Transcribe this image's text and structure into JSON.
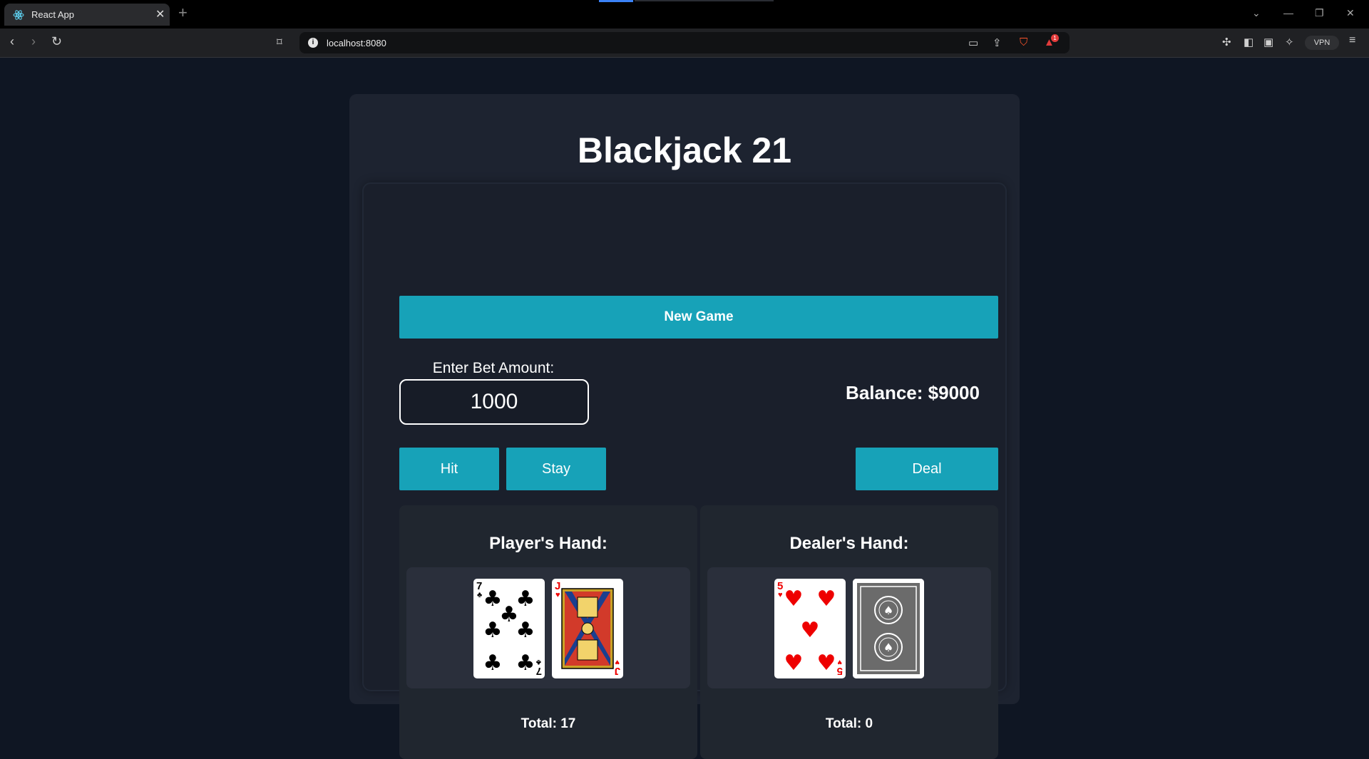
{
  "browser": {
    "tab_title": "React App",
    "tab_close": "✕",
    "new_tab": "+",
    "url": "localhost:8080",
    "vpn_label": "VPN",
    "notification_count": "1"
  },
  "app": {
    "title": "Blackjack 21",
    "new_game_label": "New Game",
    "bet_label": "Enter Bet Amount:",
    "bet_value": "1000",
    "balance_text": "Balance: $9000",
    "hit_label": "Hit",
    "stay_label": "Stay",
    "deal_label": "Deal",
    "accent_color": "#17a2b8"
  },
  "player": {
    "title": "Player's Hand:",
    "total": "Total: 17",
    "cards": [
      {
        "rank": "7",
        "suit": "clubs"
      },
      {
        "rank": "J",
        "suit": "hearts"
      }
    ]
  },
  "dealer": {
    "title": "Dealer's Hand:",
    "total": "Total: 0",
    "cards": [
      {
        "rank": "5",
        "suit": "hearts"
      },
      {
        "rank": "",
        "suit": "back"
      }
    ]
  },
  "card_glyphs": {
    "clubs": "♣",
    "hearts": "♥",
    "diamonds": "♦",
    "spades": "♠"
  }
}
